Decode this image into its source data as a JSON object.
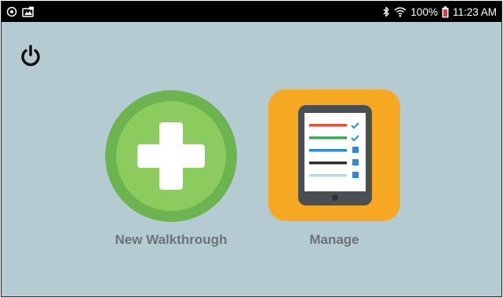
{
  "status_bar": {
    "battery_percent": "100%",
    "time": "11:23 AM",
    "left_icons": [
      "sync-icon",
      "image-notification-icon"
    ],
    "right_icons": [
      "bluetooth-icon",
      "wifi-icon",
      "battery-icon"
    ]
  },
  "toolbar": {
    "power_icon": "power-icon"
  },
  "tiles": {
    "new_walkthrough": {
      "label": "New Walkthrough",
      "icon": "plus-icon",
      "color": "#6db34f"
    },
    "manage": {
      "label": "Manage",
      "icon": "tablet-checklist-icon",
      "color": "#f7a823"
    }
  },
  "colors": {
    "background": "#b4cbd1",
    "status_bar": "#000000",
    "label_text": "#6b7278"
  }
}
